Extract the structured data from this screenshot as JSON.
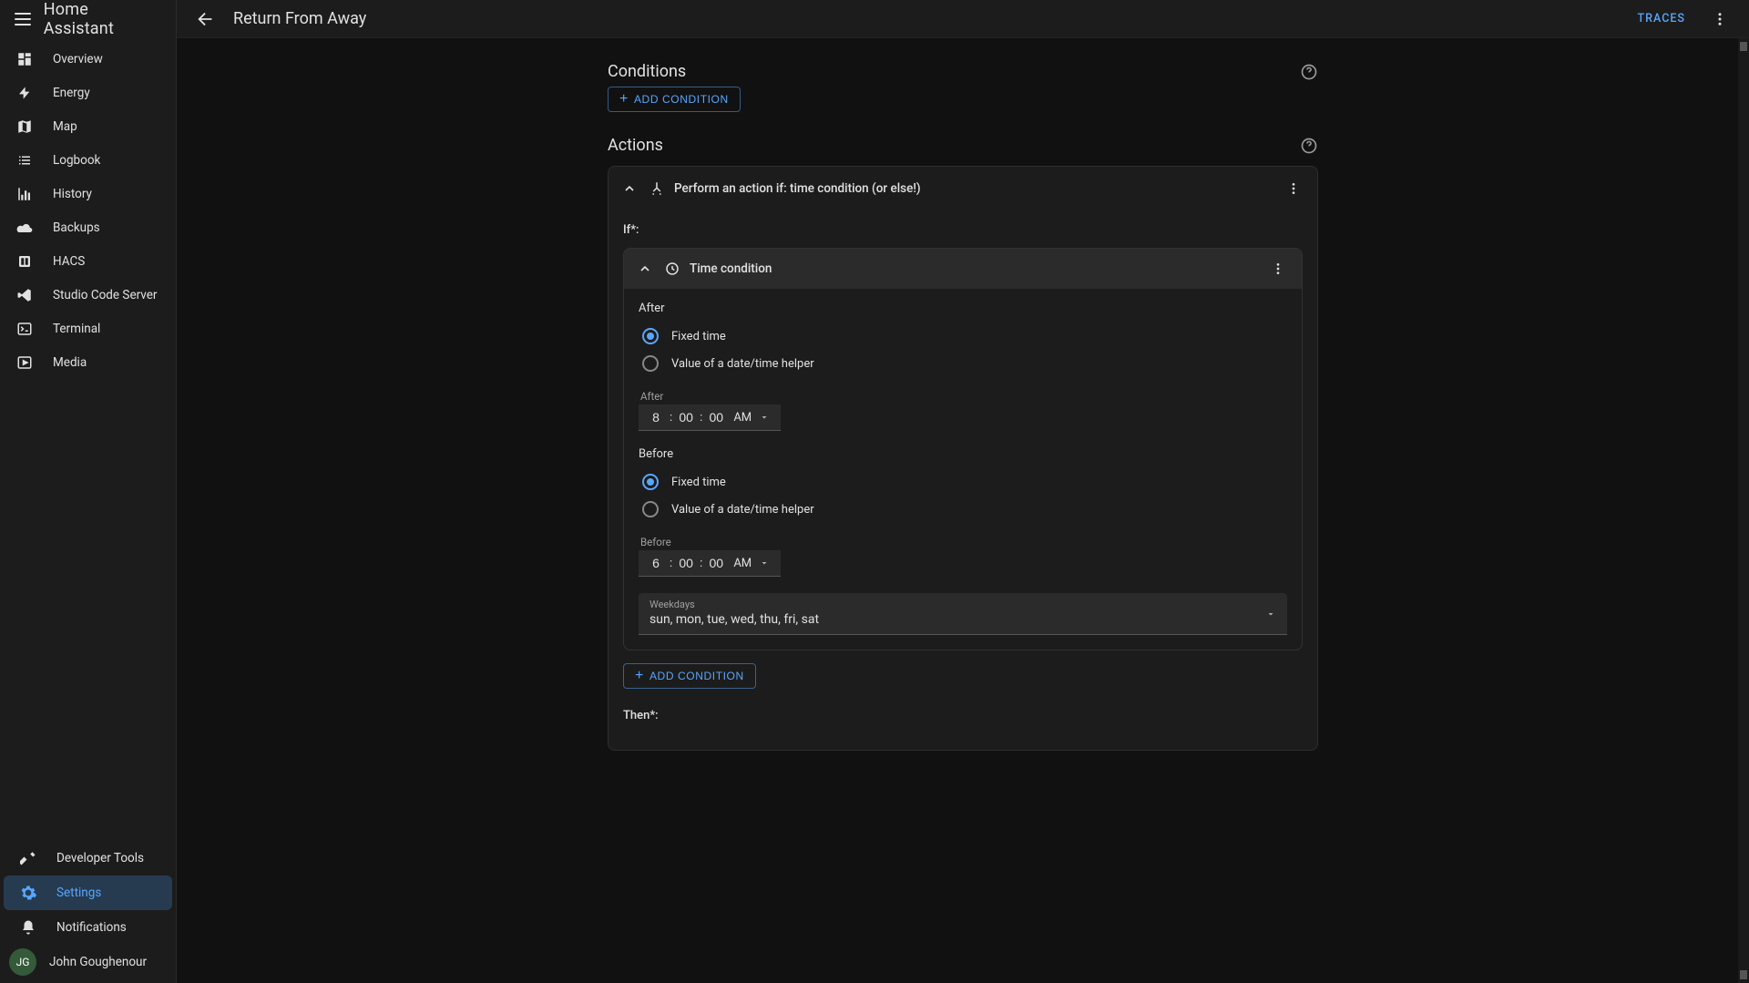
{
  "app": {
    "name": "Home Assistant"
  },
  "header": {
    "title": "Return From Away",
    "traces": "TRACES"
  },
  "sidebar": {
    "items": [
      {
        "label": "Overview",
        "icon": "dashboard"
      },
      {
        "label": "Energy",
        "icon": "bolt"
      },
      {
        "label": "Map",
        "icon": "map"
      },
      {
        "label": "Logbook",
        "icon": "list"
      },
      {
        "label": "History",
        "icon": "chart"
      },
      {
        "label": "Backups",
        "icon": "cloud"
      },
      {
        "label": "HACS",
        "icon": "hacs"
      },
      {
        "label": "Studio Code Server",
        "icon": "vscode"
      },
      {
        "label": "Terminal",
        "icon": "terminal"
      },
      {
        "label": "Media",
        "icon": "media"
      }
    ],
    "bottom": {
      "dev": "Developer Tools",
      "settings": "Settings",
      "notifications": "Notifications",
      "user_initials": "JG",
      "user_name": "John Goughenour"
    }
  },
  "sections": {
    "conditions_title": "Conditions",
    "actions_title": "Actions",
    "add_condition": "ADD CONDITION"
  },
  "action": {
    "title": "Perform an action if: time condition (or else!)",
    "if_label": "If*:",
    "then_label": "Then*:",
    "cond": {
      "title": "Time condition",
      "after_label": "After",
      "before_label": "Before",
      "opt_fixed": "Fixed time",
      "opt_helper": "Value of a date/time helper",
      "after_time_label": "After",
      "before_time_label": "Before",
      "after_time": {
        "h": "8",
        "m": "00",
        "s": "00",
        "ampm": "AM"
      },
      "before_time": {
        "h": "6",
        "m": "00",
        "s": "00",
        "ampm": "AM"
      },
      "weekdays_label": "Weekdays",
      "weekdays_value": "sun, mon, tue, wed, thu, fri, sat",
      "inner_add": "ADD CONDITION"
    }
  }
}
